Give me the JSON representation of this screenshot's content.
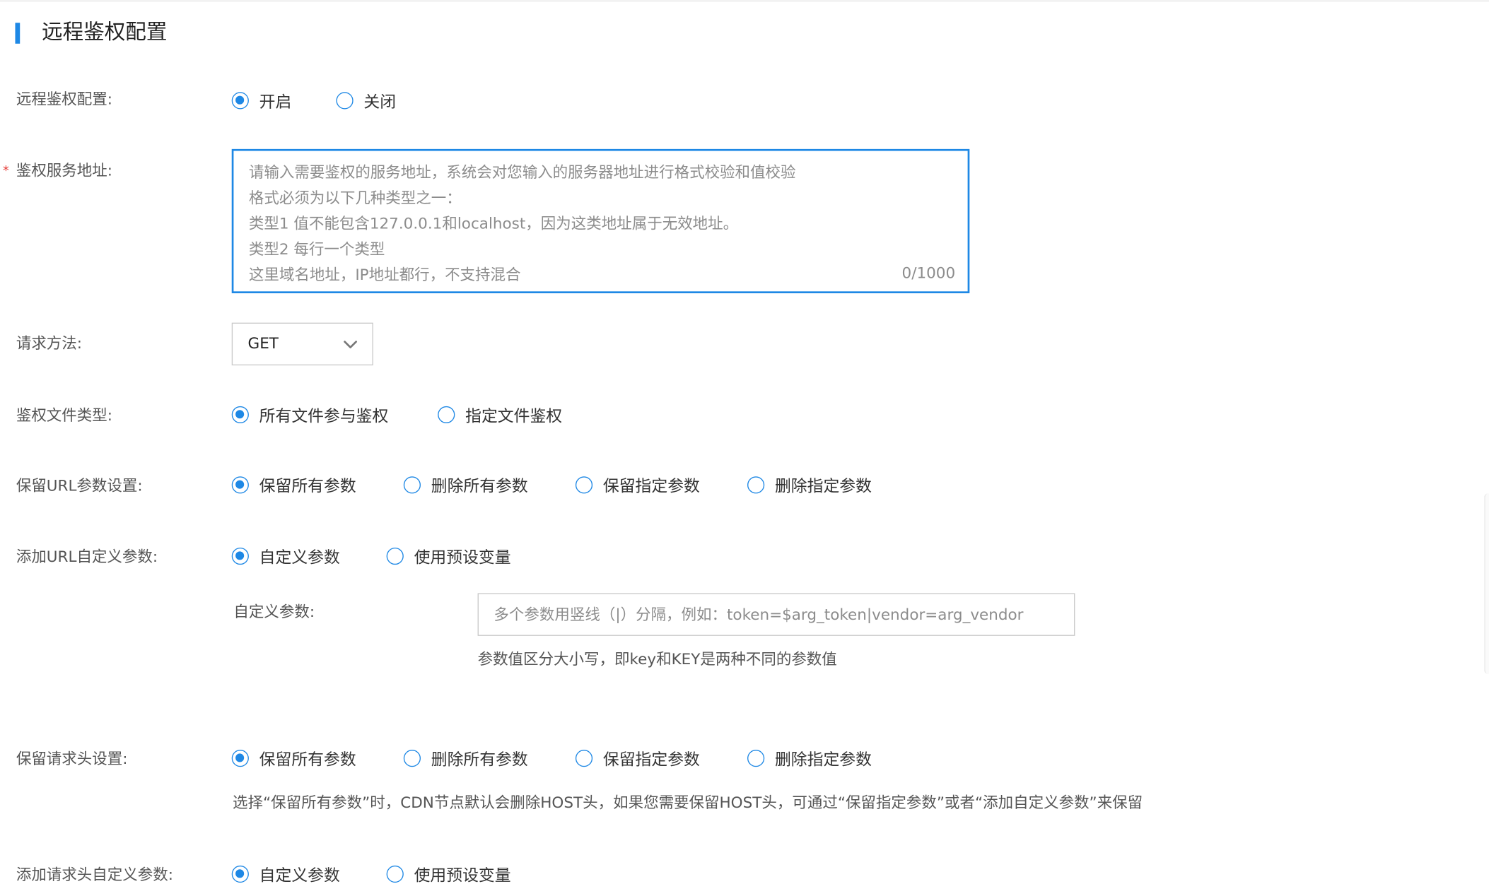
{
  "section": {
    "title": "远程鉴权配置"
  },
  "remote_auth": {
    "label": "远程鉴权配置:",
    "options": [
      "开启",
      "关闭"
    ],
    "selected": "开启"
  },
  "service_address": {
    "required_mark": "*",
    "label": "鉴权服务地址:",
    "placeholder": "请输入需要鉴权的服务地址，系统会对您输入的服务器地址进行格式校验和值校验\n格式必须为以下几种类型之一：\n类型1 值不能包含127.0.0.1和localhost，因为这类地址属于无效地址。\n类型2 每行一个类型\n这里域名地址，IP地址都行，不支持混合",
    "counter": "0/1000"
  },
  "request_method": {
    "label": "请求方法:",
    "value": "GET"
  },
  "file_type": {
    "label": "鉴权文件类型:",
    "options": [
      "所有文件参与鉴权",
      "指定文件鉴权"
    ],
    "selected": "所有文件参与鉴权"
  },
  "url_params": {
    "label": "保留URL参数设置:",
    "options": [
      "保留所有参数",
      "删除所有参数",
      "保留指定参数",
      "删除指定参数"
    ],
    "selected": "保留所有参数"
  },
  "url_custom": {
    "label": "添加URL自定义参数:",
    "options": [
      "自定义参数",
      "使用预设变量"
    ],
    "selected": "自定义参数",
    "custom_label": "自定义参数:",
    "custom_placeholder": "多个参数用竖线（|）分隔，例如：token=$arg_token|vendor=arg_vendor",
    "custom_hint": "参数值区分大小写，即key和KEY是两种不同的参数值"
  },
  "header_params": {
    "label": "保留请求头设置:",
    "options": [
      "保留所有参数",
      "删除所有参数",
      "保留指定参数",
      "删除指定参数"
    ],
    "selected": "保留所有参数",
    "hint": "选择“保留所有参数”时，CDN节点默认会删除HOST头，如果您需要保留HOST头，可通过“保留指定参数”或者“添加自定义参数”来保留"
  },
  "header_custom": {
    "label": "添加请求头自定义参数:",
    "options": [
      "自定义参数",
      "使用预设变量"
    ],
    "selected": "自定义参数"
  },
  "colors": {
    "accent": "#1e88e5",
    "required": "#e53935",
    "label": "#555555",
    "placeholder": "#8c8c8c",
    "border": "#c9c9c9"
  },
  "icons": {
    "select_arrow": "chevron-down-icon"
  }
}
